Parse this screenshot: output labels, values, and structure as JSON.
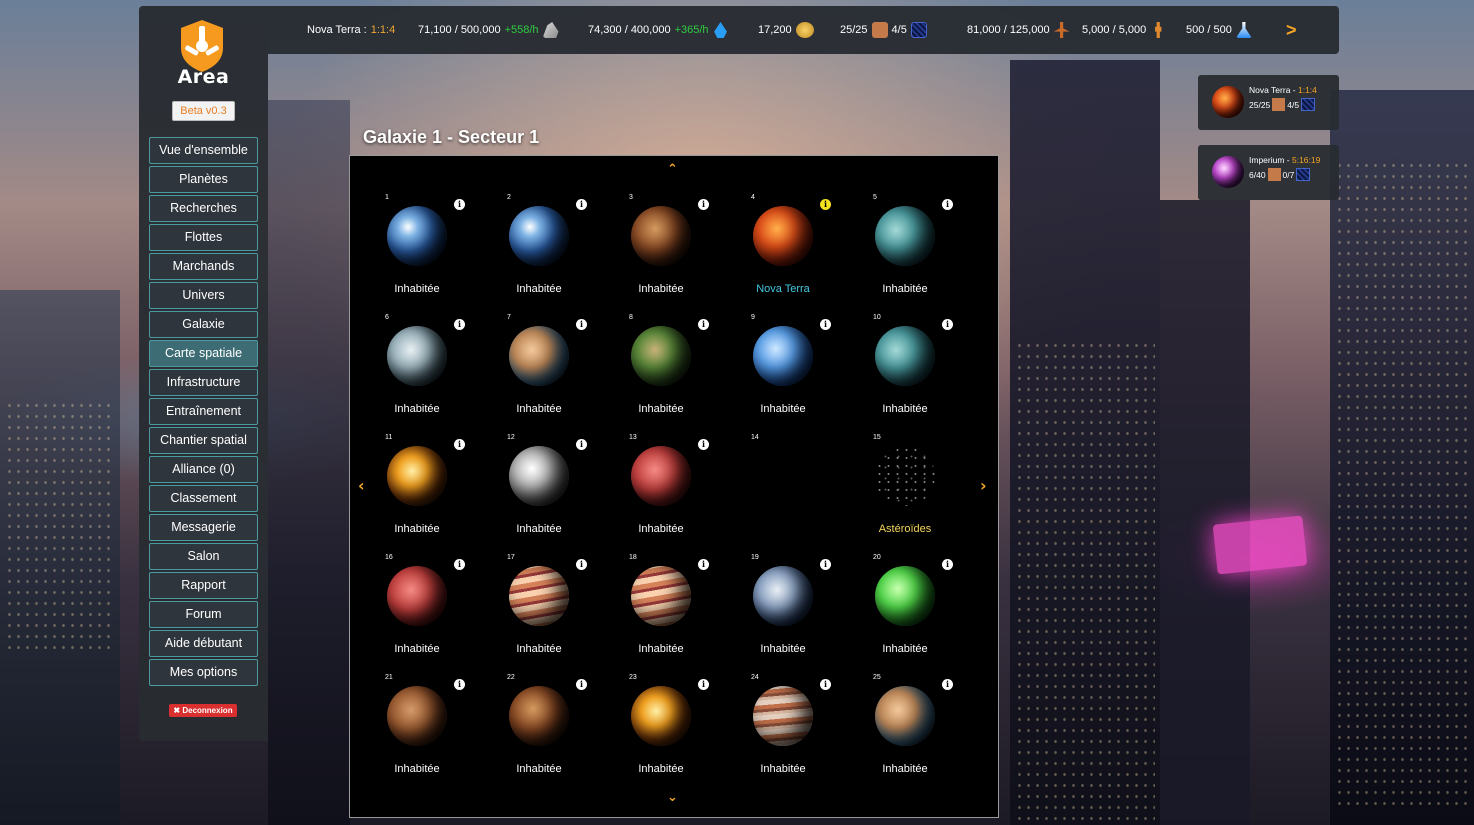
{
  "topbar": {
    "planet_name": "Nova Terra : ",
    "planet_coord": "1:1:4",
    "metal": "71,100 / 500,000",
    "metal_rate": "+558/h",
    "water": "74,300 / 400,000",
    "water_rate": "+365/h",
    "gold": "17,200",
    "fields": "25/25",
    "slots": "4/5",
    "workers": "81,000 / 125,000",
    "population": "5,000 / 5,000",
    "research": "500 / 500",
    "next_label": ">"
  },
  "sidebar": {
    "logo_text": "Area",
    "beta_label": "Beta v0.3",
    "items": [
      {
        "label": "Vue d'ensemble"
      },
      {
        "label": "Planètes"
      },
      {
        "label": "Recherches"
      },
      {
        "label": "Flottes"
      },
      {
        "label": "Marchands"
      },
      {
        "label": "Univers"
      },
      {
        "label": "Galaxie"
      },
      {
        "label": "Carte spatiale",
        "active": true
      },
      {
        "label": "Infrastructure"
      },
      {
        "label": "Entraînement"
      },
      {
        "label": "Chantier spatial"
      },
      {
        "label": "Alliance (0)"
      },
      {
        "label": "Classement"
      },
      {
        "label": "Messagerie"
      },
      {
        "label": "Salon"
      },
      {
        "label": "Rapport"
      },
      {
        "label": "Forum"
      },
      {
        "label": "Aide débutant"
      },
      {
        "label": "Mes options"
      }
    ],
    "logout_label": "✖ Deconnexion"
  },
  "map": {
    "title": "Galaxie 1 - Secteur 1",
    "nav": {
      "up": "⌃",
      "down": "⌄",
      "left": "‹",
      "right": "›"
    },
    "cells": [
      {
        "num": "1",
        "label": "Inhabitée",
        "kind": "earth"
      },
      {
        "num": "2",
        "label": "Inhabitée",
        "kind": "earth"
      },
      {
        "num": "3",
        "label": "Inhabitée",
        "kind": "dark-brown"
      },
      {
        "num": "4",
        "label": "Nova Terra",
        "kind": "lava",
        "owned": true
      },
      {
        "num": "5",
        "label": "Inhabitée",
        "kind": "teal"
      },
      {
        "num": "6",
        "label": "Inhabitée",
        "kind": "ice"
      },
      {
        "num": "7",
        "label": "Inhabitée",
        "kind": "tan-blue"
      },
      {
        "num": "8",
        "label": "Inhabitée",
        "kind": "green-jungle"
      },
      {
        "num": "9",
        "label": "Inhabitée",
        "kind": "blue"
      },
      {
        "num": "10",
        "label": "Inhabitée",
        "kind": "teal"
      },
      {
        "num": "11",
        "label": "Inhabitée",
        "kind": "fire"
      },
      {
        "num": "12",
        "label": "Inhabitée",
        "kind": "grey"
      },
      {
        "num": "13",
        "label": "Inhabitée",
        "kind": "red"
      },
      {
        "num": "14",
        "label": "",
        "kind": "empty"
      },
      {
        "num": "15",
        "label": "Astéroïdes",
        "kind": "asteroids"
      },
      {
        "num": "16",
        "label": "Inhabitée",
        "kind": "red"
      },
      {
        "num": "17",
        "label": "Inhabitée",
        "kind": "gas-peach"
      },
      {
        "num": "18",
        "label": "Inhabitée",
        "kind": "gas-peach"
      },
      {
        "num": "19",
        "label": "Inhabitée",
        "kind": "ice-blue"
      },
      {
        "num": "20",
        "label": "Inhabitée",
        "kind": "green"
      },
      {
        "num": "21",
        "label": "Inhabitée",
        "kind": "brown"
      },
      {
        "num": "22",
        "label": "Inhabitée",
        "kind": "dark-brown"
      },
      {
        "num": "23",
        "label": "Inhabitée",
        "kind": "fire"
      },
      {
        "num": "24",
        "label": "Inhabitée",
        "kind": "jupiter"
      },
      {
        "num": "25",
        "label": "Inhabitée",
        "kind": "tan-blue"
      }
    ]
  },
  "planet_cards": [
    {
      "name": "Nova Terra - ",
      "coord": "1:1:4",
      "fields": "25/25",
      "slots": "4/5",
      "kind": "lava"
    },
    {
      "name": "Imperium - ",
      "coord": "5:16:19",
      "fields": "6/40",
      "slots": "0/7",
      "kind": "purple"
    }
  ],
  "colors": {
    "accent": "#f5a623",
    "rate_green": "#2ecc40",
    "owned_planet_label": "#44c8e0",
    "asteroid_label": "#f2d45c",
    "menu_border": "#4b9aa0",
    "logout_red": "#d9302f"
  },
  "icons": [
    "metal-icon",
    "water-drop-icon",
    "gold-coins-icon",
    "fields-icon",
    "slots-grid-icon",
    "worker-icon",
    "population-icon",
    "research-flask-icon",
    "info-icon"
  ]
}
